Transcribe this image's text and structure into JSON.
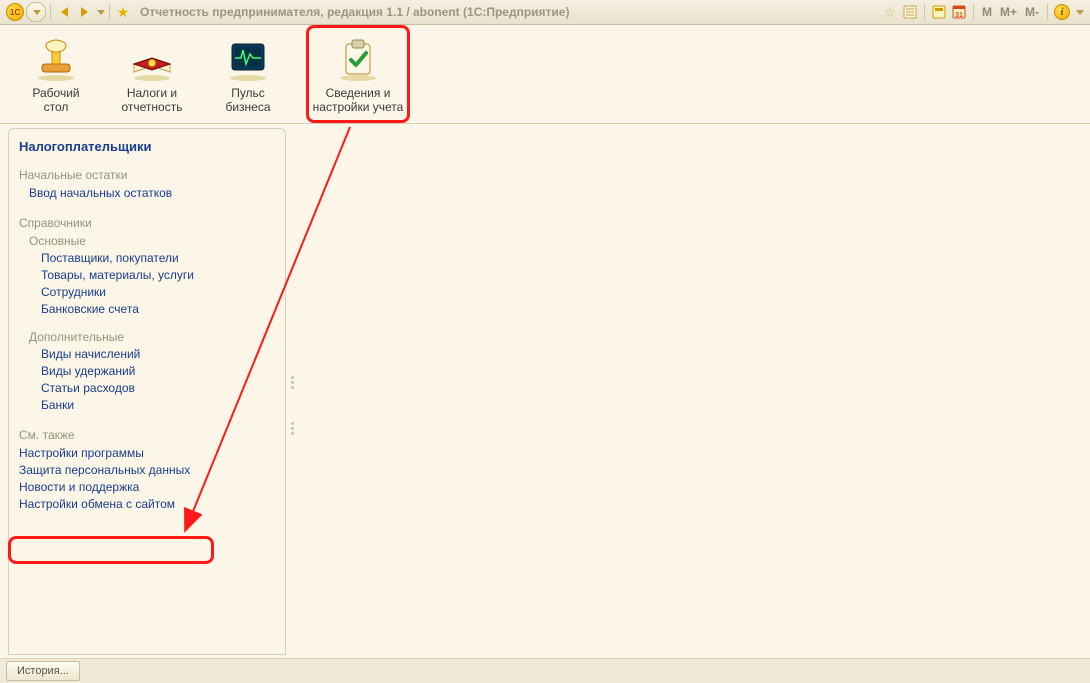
{
  "titlebar": {
    "logo_text": "1C",
    "title": "Отчетность предпринимателя, редакция 1.1 / abonent  (1С:Предприятие)",
    "m1": "M",
    "m2": "M+",
    "m3": "M-"
  },
  "toolbar": {
    "desktop": {
      "l1": "Рабочий",
      "l2": "стол"
    },
    "taxes": {
      "l1": "Налоги и",
      "l2": "отчетность"
    },
    "pulse": {
      "l1": "Пульс",
      "l2": "бизнеса"
    },
    "settings": {
      "l1": "Сведения и",
      "l2": "настройки учета"
    }
  },
  "nav": {
    "title": "Налогоплательщики",
    "g1": "Начальные остатки",
    "g1_i1": "Ввод начальных остатков",
    "g2": "Справочники",
    "g2_s1": "Основные",
    "g2_s1_i1": "Поставщики, покупатели",
    "g2_s1_i2": "Товары, материалы, услуги",
    "g2_s1_i3": "Сотрудники",
    "g2_s1_i4": "Банковские счета",
    "g2_s2": "Дополнительные",
    "g2_s2_i1": "Виды начислений",
    "g2_s2_i2": "Виды удержаний",
    "g2_s2_i3": "Статьи расходов",
    "g2_s2_i4": "Банки",
    "g3": "См. также",
    "g3_i1": "Настройки программы",
    "g3_i2": "Защита персональных данных",
    "g3_i3": "Новости и поддержка",
    "g3_i4": "Настройки обмена с сайтом"
  },
  "statusbar": {
    "history": "История..."
  }
}
